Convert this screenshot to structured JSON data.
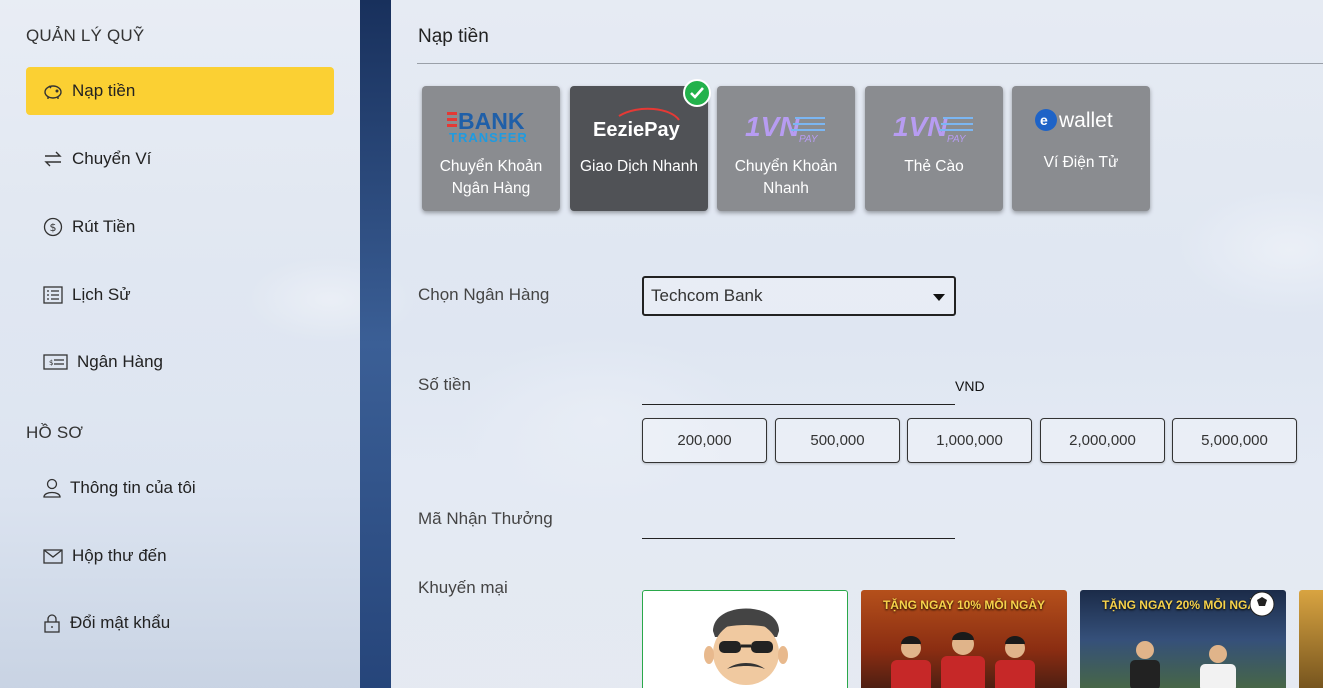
{
  "sidebar": {
    "funds_title": "QUẢN LÝ QUỸ",
    "funds_items": [
      {
        "label": "Nạp tiền",
        "icon": "piggy-bank-icon",
        "active": true
      },
      {
        "label": "Chuyển Ví",
        "icon": "transfer-arrows-icon"
      },
      {
        "label": "Rút Tiền",
        "icon": "dollar-circle-icon"
      },
      {
        "label": "Lịch Sử",
        "icon": "list-icon"
      },
      {
        "label": "Ngân Hàng",
        "icon": "bank-card-icon"
      }
    ],
    "profile_title": "HỒ SƠ",
    "profile_items": [
      {
        "label": "Thông tin của tôi",
        "icon": "user-icon"
      },
      {
        "label": "Hộp thư đến",
        "icon": "mail-icon"
      },
      {
        "label": "Đổi mật khẩu",
        "icon": "lock-icon"
      }
    ]
  },
  "main": {
    "title": "Nạp tiền",
    "methods": [
      {
        "label": "Chuyển Khoản Ngân Hàng",
        "logo_text": "BANK",
        "logo_sub": "TRANSFER",
        "selected": false
      },
      {
        "label": "Giao Dịch Nhanh",
        "logo_text": "EeziePay",
        "selected": true
      },
      {
        "label": "Chuyển Khoản Nhanh",
        "logo_text": "1VN",
        "logo_sub": "PAY",
        "selected": false
      },
      {
        "label": "Thẻ Cào",
        "logo_text": "1VN",
        "logo_sub": "PAY",
        "selected": false
      },
      {
        "label": "Ví Điện Tử",
        "logo_text": "wallet",
        "selected": false
      }
    ],
    "bank_label": "Chọn Ngân Hàng",
    "bank_value": "Techcom Bank",
    "amount_label": "Số tiền",
    "amount_value": "",
    "amount_unit": "VND",
    "quick_amounts": [
      "200,000",
      "500,000",
      "1,000,000",
      "2,000,000",
      "5,000,000"
    ],
    "bonus_code_label": "Mã Nhận Thưởng",
    "bonus_code_value": "",
    "promo_label": "Khuyến mại",
    "promos": [
      {
        "text": ""
      },
      {
        "text": "TẶNG NGAY 10% MỖI NGÀY"
      },
      {
        "text": "TẶNG NGAY 20% MỖI NGÀY"
      },
      {
        "text": ""
      }
    ]
  },
  "colors": {
    "active_nav": "#fbd033",
    "method_bg": "#8a8c90",
    "method_selected_bg": "#505256",
    "check_green": "#23b24b"
  }
}
